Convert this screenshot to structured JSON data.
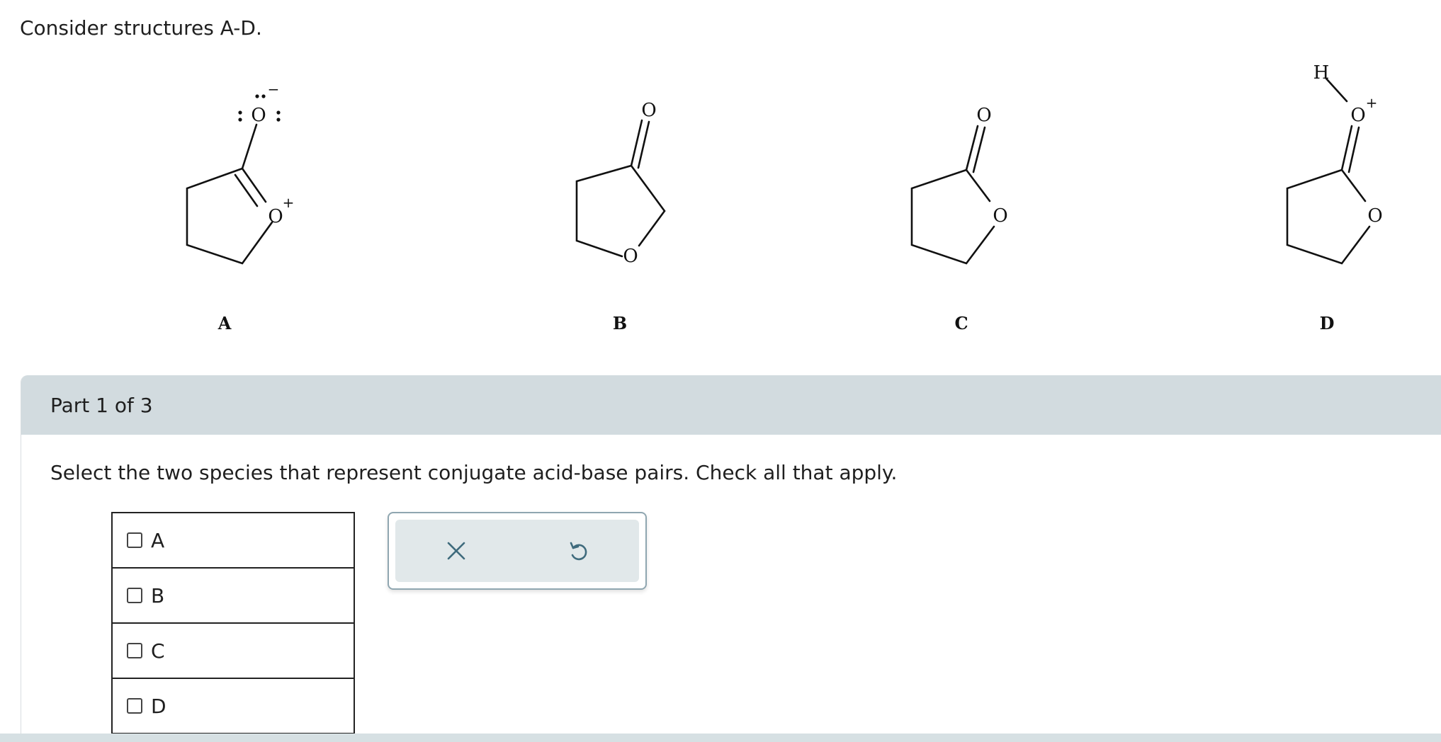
{
  "question": {
    "intro": "Consider structures A-D."
  },
  "structures": [
    {
      "label": "A",
      "atoms": [
        "O",
        "O"
      ],
      "charges": [
        "−",
        "+"
      ]
    },
    {
      "label": "B",
      "atoms": [
        "O",
        "O"
      ]
    },
    {
      "label": "C",
      "atoms": [
        "O",
        "O"
      ]
    },
    {
      "label": "D",
      "atoms": [
        "H",
        "O",
        "O"
      ],
      "charges": [
        "+"
      ]
    }
  ],
  "part": {
    "header": "Part 1 of 3",
    "prompt": "Select the two species that represent conjugate acid-base pairs. Check all that apply.",
    "choices": [
      {
        "label": "A",
        "checked": false
      },
      {
        "label": "B",
        "checked": false
      },
      {
        "label": "C",
        "checked": false
      },
      {
        "label": "D",
        "checked": false
      }
    ]
  },
  "tools": {
    "clear_icon": "close-icon",
    "reset_icon": "undo-icon"
  },
  "colors": {
    "header_bg": "#d2dbdf",
    "tool_icon": "#3f6b7d",
    "tool_bg": "#e1e8ea"
  }
}
